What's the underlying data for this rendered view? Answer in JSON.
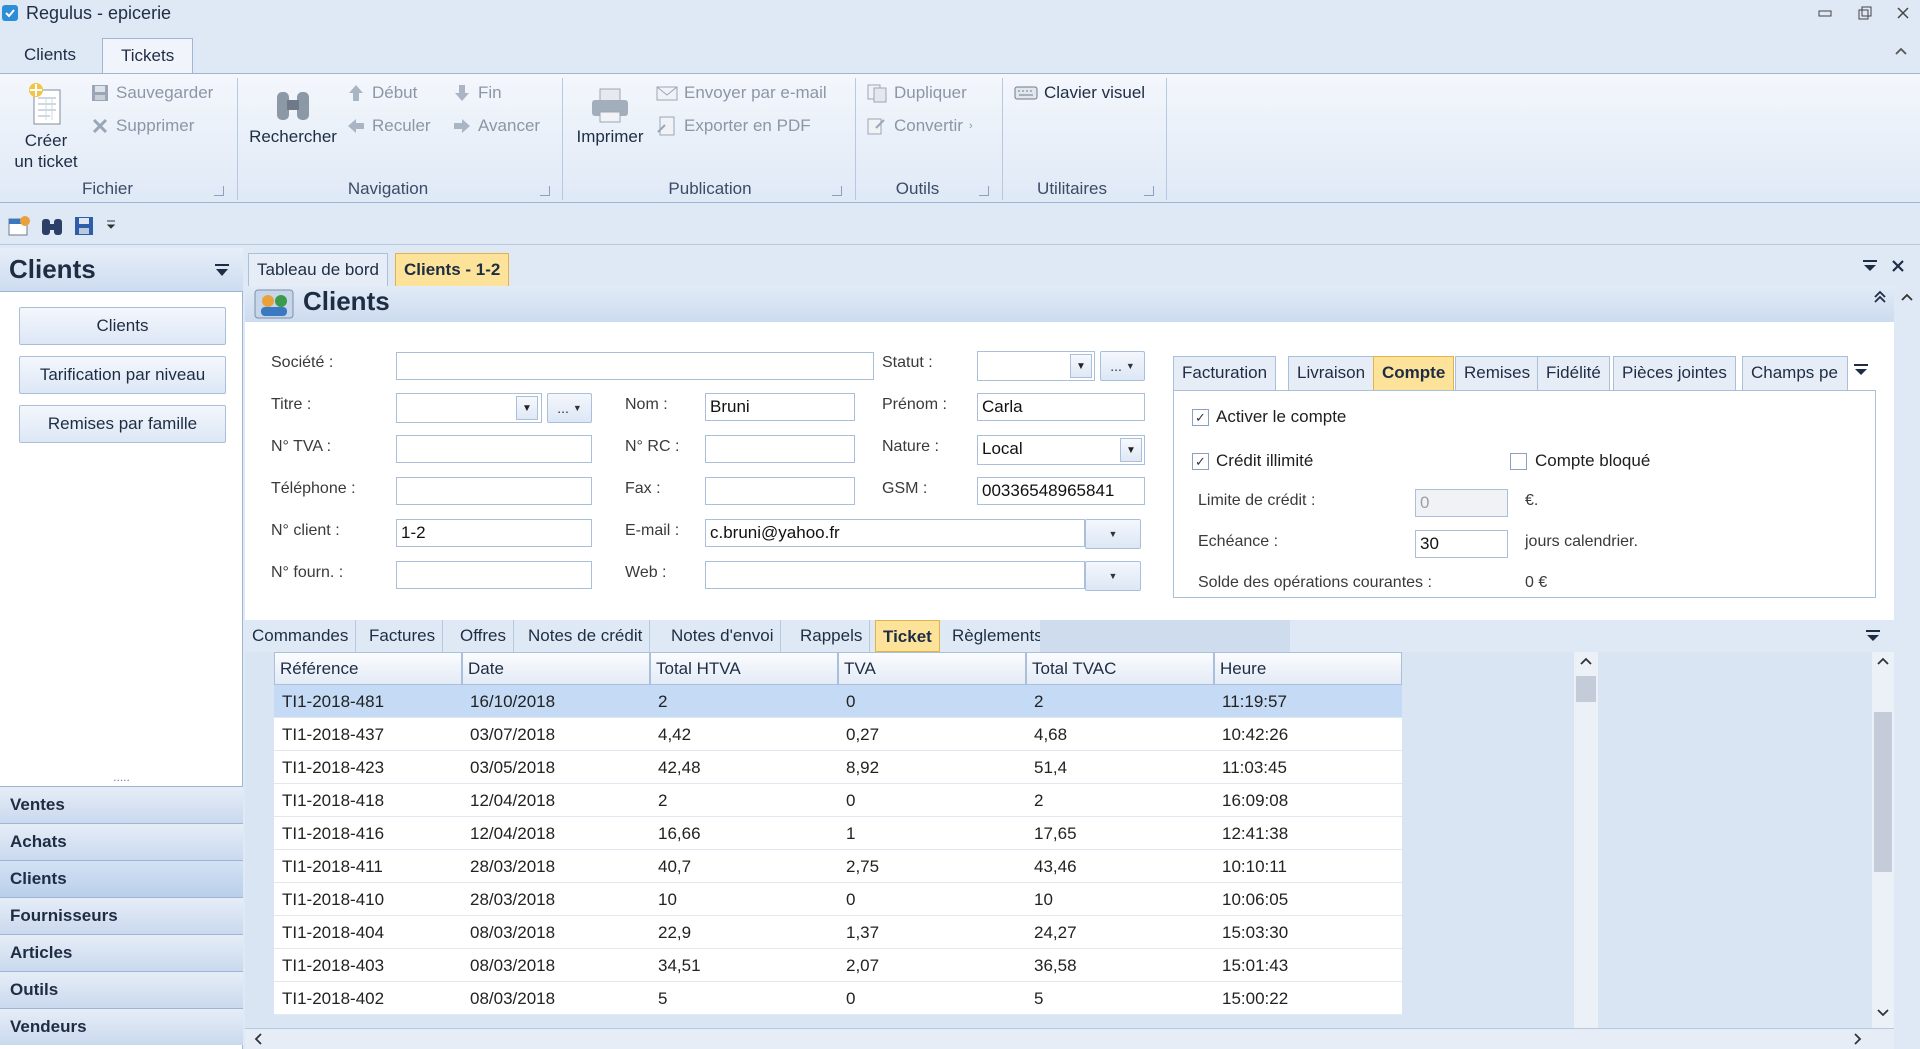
{
  "window": {
    "title": "Regulus - epicerie"
  },
  "ribbon_tabs": [
    "Clients",
    "Tickets"
  ],
  "ribbon": {
    "fichier": {
      "label": "Fichier",
      "create": "Créer un ticket",
      "create_l1": "Créer",
      "create_l2": "un ticket",
      "save": "Sauvegarder",
      "delete": "Supprimer"
    },
    "navigation": {
      "label": "Navigation",
      "search": "Rechercher",
      "start": "Début",
      "end": "Fin",
      "back": "Reculer",
      "forward": "Avancer"
    },
    "publication": {
      "label": "Publication",
      "print": "Imprimer",
      "email": "Envoyer par e-mail",
      "pdf": "Exporter en PDF"
    },
    "outils": {
      "label": "Outils",
      "duplicate": "Dupliquer",
      "convert": "Convertir"
    },
    "utilitaires": {
      "label": "Utilitaires",
      "keyboard": "Clavier visuel"
    }
  },
  "leftnav": {
    "title": "Clients",
    "buttons": [
      "Clients",
      "Tarification par niveau",
      "Remises par famille"
    ],
    "grip": ".....",
    "sections": [
      "Ventes",
      "Achats",
      "Clients",
      "Fournisseurs",
      "Articles",
      "Outils",
      "Vendeurs"
    ]
  },
  "doc_tabs": [
    "Tableau de bord",
    "Clients - 1-2"
  ],
  "main": {
    "title": "Clients"
  },
  "form": {
    "labels": {
      "societe": "Société :",
      "titre": "Titre :",
      "tva": "N° TVA :",
      "telephone": "Téléphone :",
      "client": "N° client :",
      "fourn": "N° fourn. :",
      "nom": "Nom :",
      "rc": "N° RC :",
      "fax": "Fax :",
      "email": "E-mail :",
      "web": "Web :",
      "statut": "Statut :",
      "prenom": "Prénom :",
      "nature": "Nature :",
      "gsm": "GSM :"
    },
    "values": {
      "societe": "",
      "titre": "",
      "tva": "",
      "telephone": "",
      "client": "1-2",
      "fourn": "",
      "nom": "Bruni",
      "rc": "",
      "fax": "",
      "email": "c.bruni@yahoo.fr",
      "web": "",
      "statut": "",
      "prenom": "Carla",
      "nature": "Local",
      "gsm": "00336548965841"
    },
    "more": "..."
  },
  "account": {
    "tabs": [
      "Facturation",
      "Livraison",
      "Compte",
      "Remises",
      "Fidélité",
      "Pièces jointes",
      "Champs pe"
    ],
    "activate": "Activer le compte",
    "unlimited": "Crédit illimité",
    "blocked": "Compte bloqué",
    "credit_limit_label": "Limite de crédit :",
    "credit_limit": "0",
    "credit_unit": "€.",
    "due_label": "Echéance :",
    "due": "30",
    "due_unit": "jours calendrier.",
    "balance_label": "Solde des opérations courantes :",
    "balance": "0 €",
    "activate_checked": true,
    "unlimited_checked": true,
    "blocked_checked": false
  },
  "sub_tabs": [
    "Commandes",
    "Factures",
    "Offres",
    "Notes de crédit",
    "Notes d'envoi",
    "Rappels",
    "Ticket",
    "Règlements"
  ],
  "grid": {
    "columns": [
      "Référence",
      "Date",
      "Total HTVA",
      "TVA",
      "Total TVAC",
      "Heure"
    ],
    "rows": [
      [
        "TI1-2018-481",
        "16/10/2018",
        "2",
        "0",
        "2",
        "11:19:57"
      ],
      [
        "TI1-2018-437",
        "03/07/2018",
        "4,42",
        "0,27",
        "4,68",
        "10:42:26"
      ],
      [
        "TI1-2018-423",
        "03/05/2018",
        "42,48",
        "8,92",
        "51,4",
        "11:03:45"
      ],
      [
        "TI1-2018-418",
        "12/04/2018",
        "2",
        "0",
        "2",
        "16:09:08"
      ],
      [
        "TI1-2018-416",
        "12/04/2018",
        "16,66",
        "1",
        "17,65",
        "12:41:38"
      ],
      [
        "TI1-2018-411",
        "28/03/2018",
        "40,7",
        "2,75",
        "43,46",
        "10:10:11"
      ],
      [
        "TI1-2018-410",
        "28/03/2018",
        "10",
        "0",
        "10",
        "10:06:05"
      ],
      [
        "TI1-2018-404",
        "08/03/2018",
        "22,9",
        "1,37",
        "24,27",
        "15:03:30"
      ],
      [
        "TI1-2018-403",
        "08/03/2018",
        "34,51",
        "2,07",
        "36,58",
        "15:01:43"
      ],
      [
        "TI1-2018-402",
        "08/03/2018",
        "5",
        "0",
        "5",
        "15:00:22"
      ]
    ]
  },
  "colors": {
    "accent_tab": "#fde39a",
    "selected_row": "#c4daf5",
    "chrome": "#dfe9f5"
  }
}
